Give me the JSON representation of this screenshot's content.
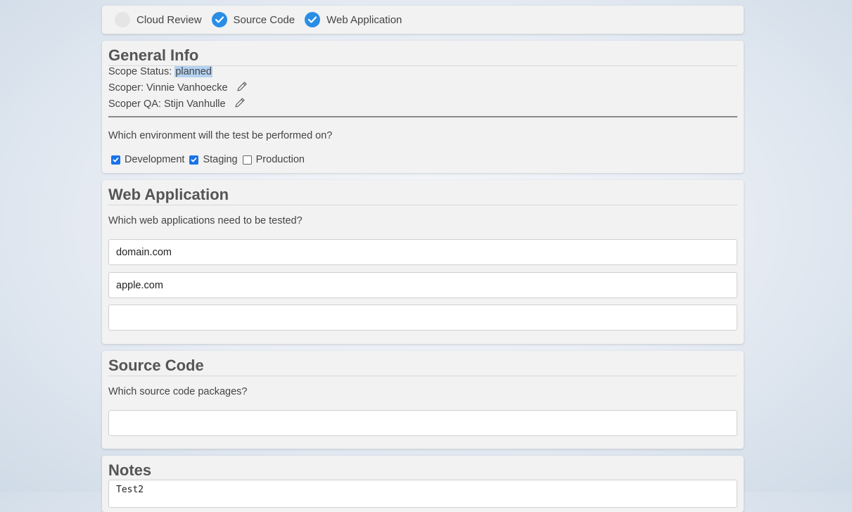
{
  "steps": [
    {
      "label": "Cloud Review",
      "checked": false
    },
    {
      "label": "Source Code",
      "checked": true
    },
    {
      "label": "Web Application",
      "checked": true
    }
  ],
  "general": {
    "title": "General Info",
    "scope_status_label": "Scope Status: ",
    "scope_status_value": "planned",
    "scoper": "Scoper: Vinnie Vanhoecke",
    "scoper_qa": "Scoper QA: Stijn Vanhulle",
    "environment_question": "Which environment will the test be performed on?",
    "environments": [
      {
        "label": "Development",
        "checked": true
      },
      {
        "label": "Staging",
        "checked": true
      },
      {
        "label": "Production",
        "checked": false
      }
    ]
  },
  "webapp": {
    "title": "Web Application",
    "question": "Which web applications need to be tested?",
    "entries": [
      "domain.com",
      "apple.com",
      ""
    ]
  },
  "source": {
    "title": "Source Code",
    "question": "Which source code packages?",
    "entries": [
      ""
    ]
  },
  "notes": {
    "title": "Notes",
    "text": "Test2"
  },
  "colors": {
    "accent": "#2a8de6",
    "checkbox": "#1a73e8",
    "highlight": "#b4d2f2"
  }
}
